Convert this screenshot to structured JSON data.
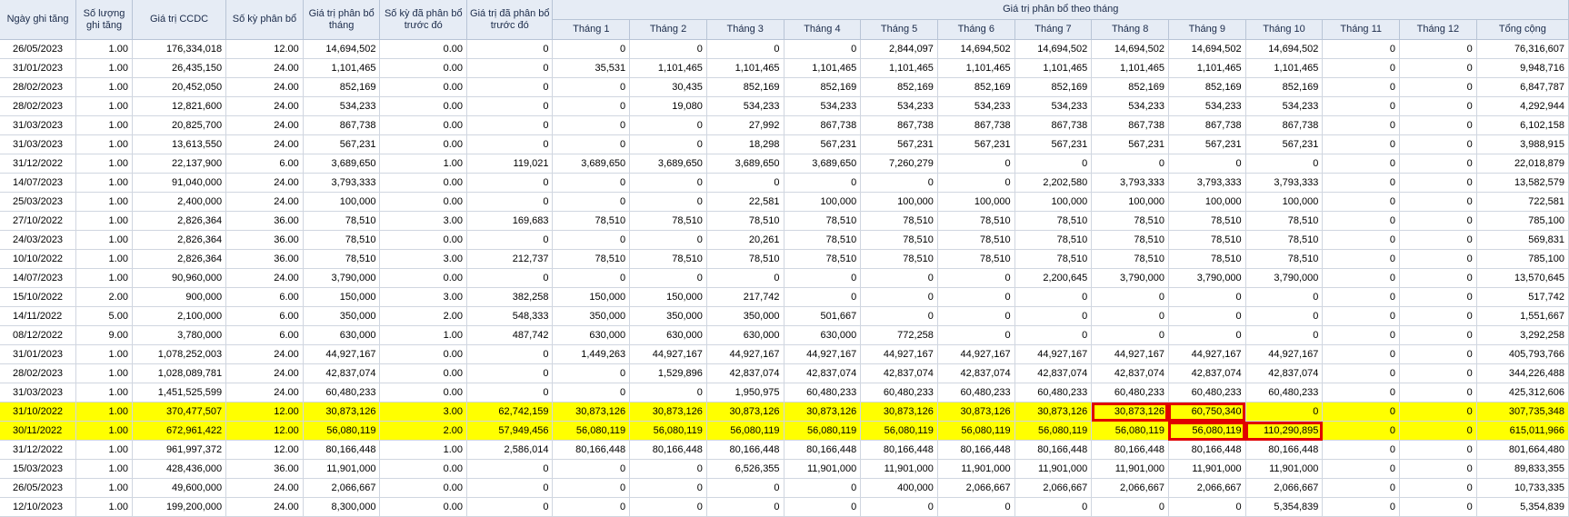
{
  "headers": {
    "ngay_ghi_tang": "Ngày ghi tăng",
    "so_luong_ghi_tang": "Số lượng ghi tăng",
    "gia_tri_ccdc": "Giá trị CCDC",
    "so_ky_phan_bo": "Số kỳ phân bổ",
    "gia_tri_phan_bo_thang": "Giá trị phân bổ tháng",
    "so_ky_da_phan_bo": "Số kỳ đã phân bổ trước đó",
    "gia_tri_da_phan_bo": "Giá trị đã phân bổ trước đó",
    "group": "Giá trị phân bổ theo tháng",
    "months": [
      "Tháng 1",
      "Tháng 2",
      "Tháng 3",
      "Tháng 4",
      "Tháng 5",
      "Tháng 6",
      "Tháng 7",
      "Tháng 8",
      "Tháng 9",
      "Tháng 10",
      "Tháng 11",
      "Tháng 12"
    ],
    "total": "Tổng cộng"
  },
  "highlight_color": "#ffff00",
  "box_color": "#e00000",
  "rows": [
    {
      "cells": [
        "26/05/2023",
        "1.00",
        "176,334,018",
        "12.00",
        "14,694,502",
        "0.00",
        "0",
        "0",
        "0",
        "0",
        "0",
        "2,844,097",
        "14,694,502",
        "14,694,502",
        "14,694,502",
        "14,694,502",
        "14,694,502",
        "0",
        "0",
        "76,316,607"
      ]
    },
    {
      "cells": [
        "31/01/2023",
        "1.00",
        "26,435,150",
        "24.00",
        "1,101,465",
        "0.00",
        "0",
        "35,531",
        "1,101,465",
        "1,101,465",
        "1,101,465",
        "1,101,465",
        "1,101,465",
        "1,101,465",
        "1,101,465",
        "1,101,465",
        "1,101,465",
        "0",
        "0",
        "9,948,716"
      ]
    },
    {
      "cells": [
        "28/02/2023",
        "1.00",
        "20,452,050",
        "24.00",
        "852,169",
        "0.00",
        "0",
        "0",
        "30,435",
        "852,169",
        "852,169",
        "852,169",
        "852,169",
        "852,169",
        "852,169",
        "852,169",
        "852,169",
        "0",
        "0",
        "6,847,787"
      ]
    },
    {
      "cells": [
        "28/02/2023",
        "1.00",
        "12,821,600",
        "24.00",
        "534,233",
        "0.00",
        "0",
        "0",
        "19,080",
        "534,233",
        "534,233",
        "534,233",
        "534,233",
        "534,233",
        "534,233",
        "534,233",
        "534,233",
        "0",
        "0",
        "4,292,944"
      ]
    },
    {
      "cells": [
        "31/03/2023",
        "1.00",
        "20,825,700",
        "24.00",
        "867,738",
        "0.00",
        "0",
        "0",
        "0",
        "27,992",
        "867,738",
        "867,738",
        "867,738",
        "867,738",
        "867,738",
        "867,738",
        "867,738",
        "0",
        "0",
        "6,102,158"
      ]
    },
    {
      "cells": [
        "31/03/2023",
        "1.00",
        "13,613,550",
        "24.00",
        "567,231",
        "0.00",
        "0",
        "0",
        "0",
        "18,298",
        "567,231",
        "567,231",
        "567,231",
        "567,231",
        "567,231",
        "567,231",
        "567,231",
        "0",
        "0",
        "3,988,915"
      ]
    },
    {
      "cells": [
        "31/12/2022",
        "1.00",
        "22,137,900",
        "6.00",
        "3,689,650",
        "1.00",
        "119,021",
        "3,689,650",
        "3,689,650",
        "3,689,650",
        "3,689,650",
        "7,260,279",
        "0",
        "0",
        "0",
        "0",
        "0",
        "0",
        "0",
        "22,018,879"
      ]
    },
    {
      "cells": [
        "14/07/2023",
        "1.00",
        "91,040,000",
        "24.00",
        "3,793,333",
        "0.00",
        "0",
        "0",
        "0",
        "0",
        "0",
        "0",
        "0",
        "2,202,580",
        "3,793,333",
        "3,793,333",
        "3,793,333",
        "0",
        "0",
        "13,582,579"
      ]
    },
    {
      "cells": [
        "25/03/2023",
        "1.00",
        "2,400,000",
        "24.00",
        "100,000",
        "0.00",
        "0",
        "0",
        "0",
        "22,581",
        "100,000",
        "100,000",
        "100,000",
        "100,000",
        "100,000",
        "100,000",
        "100,000",
        "0",
        "0",
        "722,581"
      ]
    },
    {
      "cells": [
        "27/10/2022",
        "1.00",
        "2,826,364",
        "36.00",
        "78,510",
        "3.00",
        "169,683",
        "78,510",
        "78,510",
        "78,510",
        "78,510",
        "78,510",
        "78,510",
        "78,510",
        "78,510",
        "78,510",
        "78,510",
        "0",
        "0",
        "785,100"
      ]
    },
    {
      "cells": [
        "24/03/2023",
        "1.00",
        "2,826,364",
        "36.00",
        "78,510",
        "0.00",
        "0",
        "0",
        "0",
        "20,261",
        "78,510",
        "78,510",
        "78,510",
        "78,510",
        "78,510",
        "78,510",
        "78,510",
        "0",
        "0",
        "569,831"
      ]
    },
    {
      "cells": [
        "10/10/2022",
        "1.00",
        "2,826,364",
        "36.00",
        "78,510",
        "3.00",
        "212,737",
        "78,510",
        "78,510",
        "78,510",
        "78,510",
        "78,510",
        "78,510",
        "78,510",
        "78,510",
        "78,510",
        "78,510",
        "0",
        "0",
        "785,100"
      ]
    },
    {
      "cells": [
        "14/07/2023",
        "1.00",
        "90,960,000",
        "24.00",
        "3,790,000",
        "0.00",
        "0",
        "0",
        "0",
        "0",
        "0",
        "0",
        "0",
        "2,200,645",
        "3,790,000",
        "3,790,000",
        "3,790,000",
        "0",
        "0",
        "13,570,645"
      ]
    },
    {
      "cells": [
        "15/10/2022",
        "2.00",
        "900,000",
        "6.00",
        "150,000",
        "3.00",
        "382,258",
        "150,000",
        "150,000",
        "217,742",
        "0",
        "0",
        "0",
        "0",
        "0",
        "0",
        "0",
        "0",
        "0",
        "517,742"
      ]
    },
    {
      "cells": [
        "14/11/2022",
        "5.00",
        "2,100,000",
        "6.00",
        "350,000",
        "2.00",
        "548,333",
        "350,000",
        "350,000",
        "350,000",
        "501,667",
        "0",
        "0",
        "0",
        "0",
        "0",
        "0",
        "0",
        "0",
        "1,551,667"
      ]
    },
    {
      "cells": [
        "08/12/2022",
        "9.00",
        "3,780,000",
        "6.00",
        "630,000",
        "1.00",
        "487,742",
        "630,000",
        "630,000",
        "630,000",
        "630,000",
        "772,258",
        "0",
        "0",
        "0",
        "0",
        "0",
        "0",
        "0",
        "3,292,258"
      ]
    },
    {
      "cells": [
        "31/01/2023",
        "1.00",
        "1,078,252,003",
        "24.00",
        "44,927,167",
        "0.00",
        "0",
        "1,449,263",
        "44,927,167",
        "44,927,167",
        "44,927,167",
        "44,927,167",
        "44,927,167",
        "44,927,167",
        "44,927,167",
        "44,927,167",
        "44,927,167",
        "0",
        "0",
        "405,793,766"
      ]
    },
    {
      "cells": [
        "28/02/2023",
        "1.00",
        "1,028,089,781",
        "24.00",
        "42,837,074",
        "0.00",
        "0",
        "0",
        "1,529,896",
        "42,837,074",
        "42,837,074",
        "42,837,074",
        "42,837,074",
        "42,837,074",
        "42,837,074",
        "42,837,074",
        "42,837,074",
        "0",
        "0",
        "344,226,488"
      ]
    },
    {
      "cells": [
        "31/03/2023",
        "1.00",
        "1,451,525,599",
        "24.00",
        "60,480,233",
        "0.00",
        "0",
        "0",
        "0",
        "1,950,975",
        "60,480,233",
        "60,480,233",
        "60,480,233",
        "60,480,233",
        "60,480,233",
        "60,480,233",
        "60,480,233",
        "0",
        "0",
        "425,312,606"
      ]
    },
    {
      "highlight": true,
      "boxed": [
        14,
        15
      ],
      "cells": [
        "31/10/2022",
        "1.00",
        "370,477,507",
        "12.00",
        "30,873,126",
        "3.00",
        "62,742,159",
        "30,873,126",
        "30,873,126",
        "30,873,126",
        "30,873,126",
        "30,873,126",
        "30,873,126",
        "30,873,126",
        "30,873,126",
        "60,750,340",
        "0",
        "0",
        "0",
        "307,735,348"
      ]
    },
    {
      "highlight": true,
      "boxed": [
        15,
        16
      ],
      "cells": [
        "30/11/2022",
        "1.00",
        "672,961,422",
        "12.00",
        "56,080,119",
        "2.00",
        "57,949,456",
        "56,080,119",
        "56,080,119",
        "56,080,119",
        "56,080,119",
        "56,080,119",
        "56,080,119",
        "56,080,119",
        "56,080,119",
        "56,080,119",
        "110,290,895",
        "0",
        "0",
        "615,011,966"
      ]
    },
    {
      "cells": [
        "31/12/2022",
        "1.00",
        "961,997,372",
        "12.00",
        "80,166,448",
        "1.00",
        "2,586,014",
        "80,166,448",
        "80,166,448",
        "80,166,448",
        "80,166,448",
        "80,166,448",
        "80,166,448",
        "80,166,448",
        "80,166,448",
        "80,166,448",
        "80,166,448",
        "0",
        "0",
        "801,664,480"
      ]
    },
    {
      "cells": [
        "15/03/2023",
        "1.00",
        "428,436,000",
        "36.00",
        "11,901,000",
        "0.00",
        "0",
        "0",
        "0",
        "6,526,355",
        "11,901,000",
        "11,901,000",
        "11,901,000",
        "11,901,000",
        "11,901,000",
        "11,901,000",
        "11,901,000",
        "0",
        "0",
        "89,833,355"
      ]
    },
    {
      "cells": [
        "26/05/2023",
        "1.00",
        "49,600,000",
        "24.00",
        "2,066,667",
        "0.00",
        "0",
        "0",
        "0",
        "0",
        "0",
        "400,000",
        "2,066,667",
        "2,066,667",
        "2,066,667",
        "2,066,667",
        "2,066,667",
        "0",
        "0",
        "10,733,335"
      ]
    },
    {
      "cells": [
        "12/10/2023",
        "1.00",
        "199,200,000",
        "24.00",
        "8,300,000",
        "0.00",
        "0",
        "0",
        "0",
        "0",
        "0",
        "0",
        "0",
        "0",
        "0",
        "0",
        "5,354,839",
        "0",
        "0",
        "5,354,839"
      ]
    }
  ]
}
